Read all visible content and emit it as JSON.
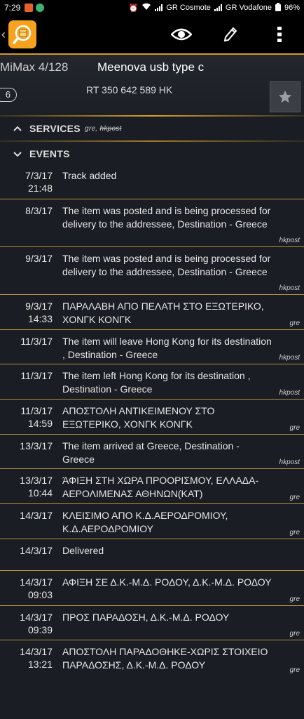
{
  "statusbar": {
    "time": "7:29",
    "carrier1": "GR Cosmote",
    "carrier2": "GR Vodafone",
    "battery": "96%"
  },
  "toolbar": {
    "back_icon": "chevron-left-icon",
    "logo_icon": "package-search-icon",
    "actions": [
      "eye-icon",
      "pencil-icon",
      "more-vert-icon"
    ]
  },
  "header": {
    "device": "MiMax 4/128",
    "title": "Meenova usb type c",
    "tracking_number": "RT 350 642 589 HK",
    "count_badge": "6"
  },
  "sections": {
    "services_label": "SERVICES",
    "services_sub_plain": "gre,",
    "services_sub_struck": "hkpost",
    "events_label": "EVENTS"
  },
  "colors": {
    "accent": "#f6a21f",
    "divider": "#b89042",
    "background": "#1b1d24"
  },
  "events": [
    {
      "date": "7/3/17",
      "time": "21:48",
      "text": "Track added",
      "source": ""
    },
    {
      "date": "8/3/17",
      "time": "",
      "text": "The item was posted and is being processed for delivery to the addressee, Destination - Greece",
      "source": "hkpost"
    },
    {
      "date": "9/3/17",
      "time": "",
      "text": "The item was posted and is being processed for delivery to the addressee, Destination - Greece",
      "source": "hkpost"
    },
    {
      "date": "9/3/17",
      "time": "14:33",
      "text": "ΠΑΡΑΛΑΒΗ ΑΠΟ ΠΕΛΑΤΗ ΣΤΟ ΕΞΩΤΕΡΙΚΟ, ΧΟΝΓΚ ΚΟΝΓΚ",
      "source": "gre"
    },
    {
      "date": "11/3/17",
      "time": "",
      "text": "The item will leave Hong Kong for its destination , Destination - Greece",
      "source": "hkpost"
    },
    {
      "date": "11/3/17",
      "time": "",
      "text": "The item left Hong Kong for its destination , Destination - Greece",
      "source": "hkpost"
    },
    {
      "date": "11/3/17",
      "time": "14:59",
      "text": "ΑΠΟΣΤΟΛΗ ΑΝΤΙΚΕΙΜΕΝΟΥ ΣΤΟ ΕΞΩΤΕΡΙΚΟ, ΧΟΝΓΚ ΚΟΝΓΚ",
      "source": "gre"
    },
    {
      "date": "13/3/17",
      "time": "",
      "text": "The item arrived at Greece, Destination - Greece",
      "source": "hkpost"
    },
    {
      "date": "13/3/17",
      "time": "10:44",
      "text": "ΆΦΙΞΗ ΣΤΗ ΧΩΡΑ ΠΡΟΟΡΙΣΜΟΥ, ΕΛΛΑΔΑ-ΑΕΡΟΛΙΜΕΝΑΣ ΑΘΗΝΩΝ(ΚΑΤ)",
      "source": "gre"
    },
    {
      "date": "14/3/17",
      "time": "",
      "text": "ΚΛΕΙΣΙΜΟ ΑΠΟ Κ.Δ.ΑΕΡΟΔΡΟΜΙΟΥ, Κ.Δ.ΑΕΡΟΔΡΟΜΙΟΥ",
      "source": "gre"
    },
    {
      "date": "14/3/17",
      "time": "",
      "text": "Delivered",
      "source": ""
    },
    {
      "date": "14/3/17",
      "time": "09:03",
      "text": "ΑΦΙΞΗ ΣΕ Δ.Κ.-Μ.Δ. ΡΟΔΟΥ, Δ.Κ.-Μ.Δ. ΡΟΔΟΥ",
      "source": "gre"
    },
    {
      "date": "14/3/17",
      "time": "09:39",
      "text": "ΠΡΟΣ ΠΑΡΑΔΟΣΗ, Δ.Κ.-Μ.Δ. ΡΟΔΟΥ",
      "source": "gre"
    },
    {
      "date": "14/3/17",
      "time": "13:21",
      "text": "ΑΠΟΣΤΟΛΗ ΠΑΡΑΔΟΘΗΚΕ-ΧΩΡΙΣ ΣΤΟΙΧΕΙΟ ΠΑΡΑΔΟΣΗΣ, Δ.Κ.-Μ.Δ. ΡΟΔΟΥ",
      "source": "gre"
    }
  ]
}
